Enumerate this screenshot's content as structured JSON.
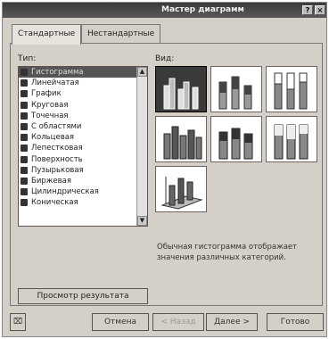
{
  "titlebar": {
    "title": "Мастер диаграмм",
    "help": "?",
    "close": "×"
  },
  "tabs": [
    {
      "label": "Стандартные"
    },
    {
      "label": "Нестандартные"
    }
  ],
  "type_label": "Тип:",
  "view_label": "Вид:",
  "chart_types": [
    {
      "label": "Гистограмма",
      "icon": "bar-chart-icon",
      "selected": true
    },
    {
      "label": "Линейчатая",
      "icon": "horizontal-bar-icon"
    },
    {
      "label": "График",
      "icon": "line-chart-icon"
    },
    {
      "label": "Круговая",
      "icon": "pie-chart-icon"
    },
    {
      "label": "Точечная",
      "icon": "scatter-icon"
    },
    {
      "label": "С областями",
      "icon": "area-chart-icon"
    },
    {
      "label": "Кольцевая",
      "icon": "doughnut-icon"
    },
    {
      "label": "Лепестковая",
      "icon": "radar-icon"
    },
    {
      "label": "Поверхность",
      "icon": "surface-icon"
    },
    {
      "label": "Пузырьковая",
      "icon": "bubble-icon"
    },
    {
      "label": "Биржевая",
      "icon": "stock-icon"
    },
    {
      "label": "Цилиндрическая",
      "icon": "cylinder-icon"
    },
    {
      "label": "Коническая",
      "icon": "cone-icon"
    }
  ],
  "description": "Обычная гистограмма отображает значения различных категорий.",
  "preview_button": "Просмотр результата",
  "buttons": {
    "cancel": "Отмена",
    "back": "< Назад",
    "next": "Далее >",
    "finish": "Готово"
  }
}
